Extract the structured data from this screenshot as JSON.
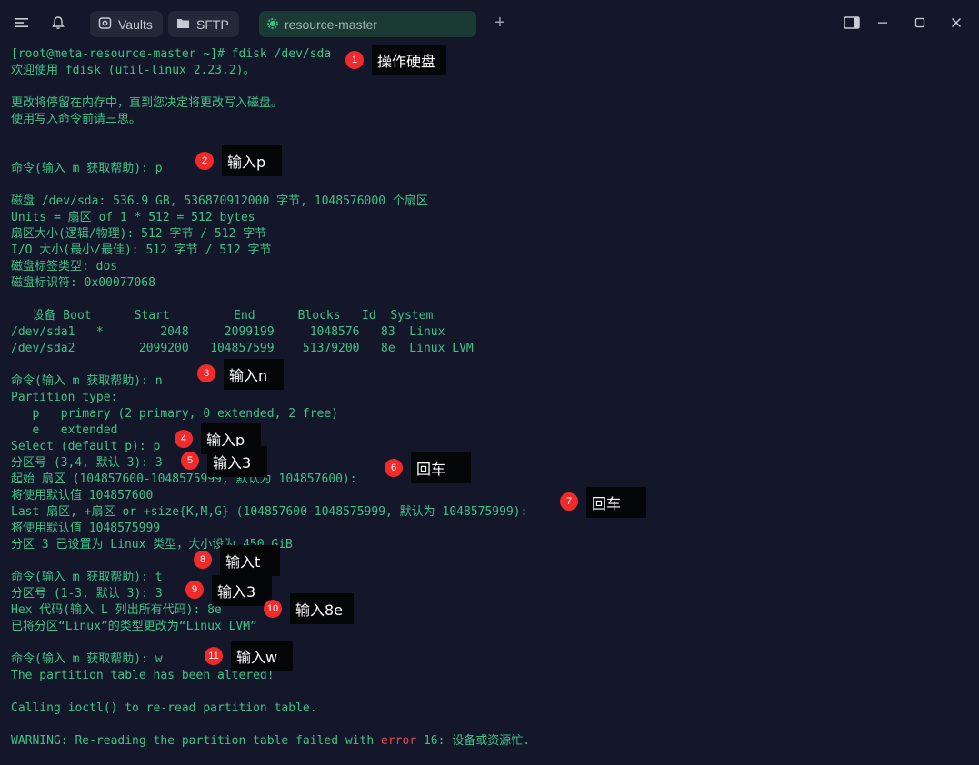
{
  "titlebar": {
    "tabs": [
      {
        "label": "Vaults",
        "icon": "vault-icon"
      },
      {
        "label": "SFTP",
        "icon": "folder-icon"
      },
      {
        "label": "resource-master",
        "icon": "gear-status-icon",
        "active": true
      }
    ],
    "accent": "#3fc288"
  },
  "terminal": {
    "lines": [
      "[root@meta-resource-master ~]# fdisk /dev/sda",
      "欢迎使用 fdisk (util-linux 2.23.2)。",
      "",
      "更改将停留在内存中，直到您决定将更改写入磁盘。",
      "使用写入命令前请三思。",
      "",
      "",
      "命令(输入 m 获取帮助): p",
      "",
      "磁盘 /dev/sda: 536.9 GB, 536870912000 字节, 1048576000 个扇区",
      "Units = 扇区 of 1 * 512 = 512 bytes",
      "扇区大小(逻辑/物理): 512 字节 / 512 字节",
      "I/O 大小(最小/最佳): 512 字节 / 512 字节",
      "磁盘标签类型: dos",
      "磁盘标识符: 0x00077068",
      "",
      "   设备 Boot      Start         End      Blocks   Id  System",
      "/dev/sda1   *        2048     2099199     1048576   83  Linux",
      "/dev/sda2         2099200   104857599    51379200   8e  Linux LVM",
      "",
      "命令(输入 m 获取帮助): n",
      "Partition type:",
      "   p   primary (2 primary, 0 extended, 2 free)",
      "   e   extended",
      "Select (default p): p",
      "分区号 (3,4, 默认 3): 3",
      "起始 扇区 (104857600-1048575999, 默认为 104857600):",
      "将使用默认值 104857600",
      "Last 扇区, +扇区 or +size{K,M,G} (104857600-1048575999, 默认为 1048575999):",
      "将使用默认值 1048575999",
      "分区 3 已设置为 Linux 类型，大小设为 450 GiB",
      "",
      "命令(输入 m 获取帮助): t",
      "分区号 (1-3, 默认 3): 3",
      "Hex 代码(输入 L 列出所有代码): 8e",
      "已将分区“Linux”的类型更改为“Linux LVM”",
      "",
      "命令(输入 m 获取帮助): w",
      "The partition table has been altered!",
      "",
      "Calling ioctl() to re-read partition table.",
      "",
      "WARNING: Re-reading the partition table failed with"
    ],
    "warning_error_word": "error",
    "warning_tail": " 16: 设备或资源忙."
  },
  "annotations": [
    {
      "num": "1",
      "text": "操作硬盘"
    },
    {
      "num": "2",
      "text": "输入p"
    },
    {
      "num": "3",
      "text": "输入n"
    },
    {
      "num": "4",
      "text": "输入p"
    },
    {
      "num": "5",
      "text": "输入3"
    },
    {
      "num": "6",
      "text": "回车"
    },
    {
      "num": "7",
      "text": "回车"
    },
    {
      "num": "8",
      "text": "输入t"
    },
    {
      "num": "9",
      "text": "输入3"
    },
    {
      "num": "10",
      "text": "输入8e"
    },
    {
      "num": "11",
      "text": "输入w"
    }
  ]
}
